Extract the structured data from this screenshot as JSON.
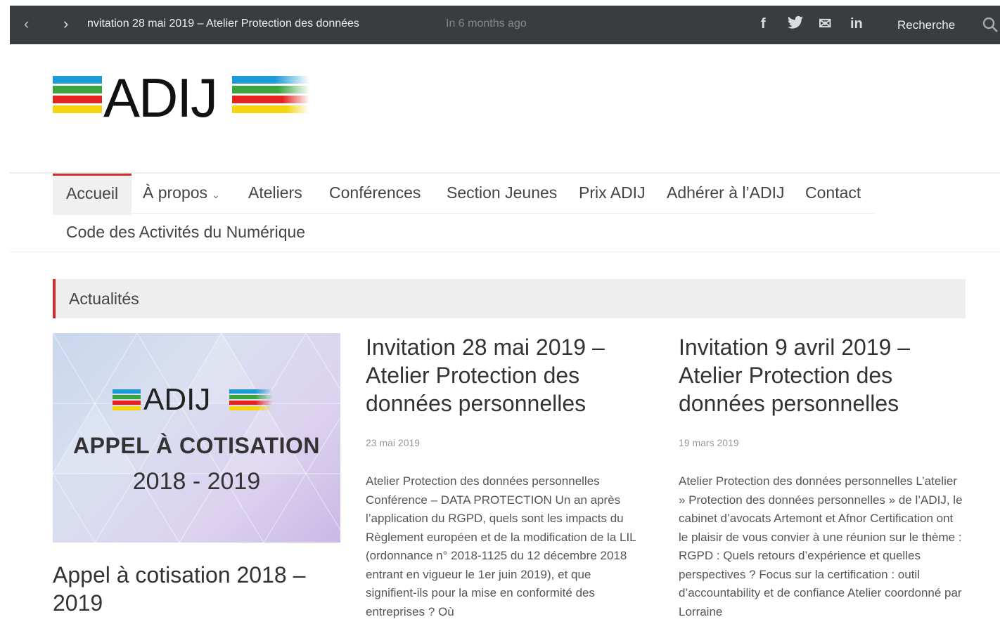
{
  "topbar": {
    "prev_icon": "‹",
    "next_icon": "›",
    "ticker_text": "nvitation 28 mai 2019 – Atelier Protection des données",
    "ticker_time": "In 6 months ago",
    "social": {
      "facebook": "f",
      "twitter": "t",
      "email": "✉",
      "linkedin": "in"
    },
    "search_label": "Recherche"
  },
  "logo": {
    "text": "ADIJ",
    "colors": [
      "#1a9ad6",
      "#3aa53c",
      "#e52420",
      "#f6d40e"
    ]
  },
  "nav": {
    "items": [
      {
        "label": "Accueil",
        "active": true
      },
      {
        "label": "À propos",
        "has_dropdown": true,
        "chevron": "⌄"
      },
      {
        "label": "Ateliers"
      },
      {
        "label": "Conférences"
      },
      {
        "label": "Section Jeunes"
      },
      {
        "label": "Prix ADIJ"
      },
      {
        "label": "Adhérer à l’ADIJ"
      },
      {
        "label": "Contact"
      },
      {
        "label": "Code des Activités du Numérique"
      }
    ]
  },
  "section": {
    "title": "Actualités"
  },
  "featured": {
    "image_logo": "ADIJ",
    "image_title": "APPEL À COTISATION",
    "image_years": "2018 - 2019",
    "title": "Appel à cotisation 2018 – 2019"
  },
  "posts": [
    {
      "title": "Invitation 28 mai 2019 – Atelier Protection des données personnelles",
      "date": "23 mai 2019",
      "excerpt": "Atelier Protection des données personnelles Conférence – DATA PROTECTION Un an après l’application du RGPD, quels sont les impacts du Règlement européen et de la modification de la LIL (ordonnance n° 2018-1125 du 12 décembre 2018 entrant en vigueur le 1er juin 2019), et que signifient-ils pour la mise en conformité des entreprises ? Où"
    },
    {
      "title": "Invitation 9 avril 2019 – Atelier Protection des données personnelles",
      "date": "19 mars 2019",
      "excerpt": "Atelier Protection des données personnelles L’atelier  » Protection des données personnelles » de l’ADIJ, le cabinet d’avocats Artemont et Afnor Certification ont le plaisir de vous convier à une réunion sur le thème : RGPD : Quels retours d’expérience et quelles perspectives ? Focus sur la certification : outil d’accountability et de confiance Atelier coordonné par Lorraine"
    }
  ]
}
